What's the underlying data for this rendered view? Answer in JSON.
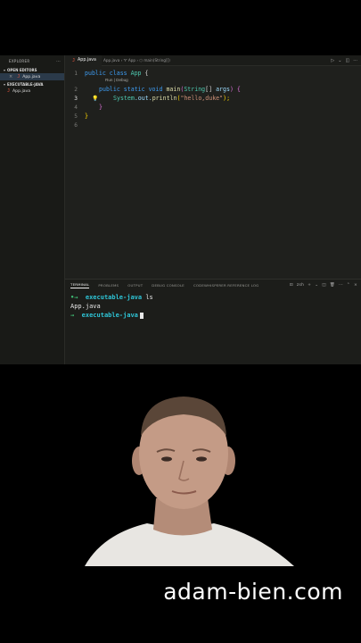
{
  "sidebar": {
    "title": "EXPLORER",
    "menu": "···",
    "open_editors_label": "OPEN EDITORS",
    "open_editor_file": "App.java",
    "folder_label": "EXECUTABLE-JAVA",
    "folder_file": "App.java"
  },
  "editor": {
    "tab_label": "App.java",
    "breadcrumb": "App.java › 🝖 App › ⬡ main(String[])",
    "codelens": "Run | Debug",
    "line_numbers": [
      "1",
      "2",
      "3",
      "4",
      "5",
      "6"
    ],
    "code": {
      "l1_kw": "public class ",
      "l1_type": "App",
      "l1_brace": " {",
      "l2_kw": "public static void ",
      "l2_fn": "main",
      "l2_paren": "(",
      "l2_type": "String",
      "l2_arr": "[] ",
      "l2_var": "args",
      "l2_close": ") {",
      "l3_sys": "System",
      "l3_out": ".out.",
      "l3_fn": "println",
      "l3_open": "(",
      "l3_str": "\"hello,duke\"",
      "l3_close": ");",
      "l4_brace": "}",
      "l5_brace": "}"
    }
  },
  "panel": {
    "tabs": [
      "TERMINAL",
      "PROBLEMS",
      "OUTPUT",
      "DEBUG CONSOLE",
      "CODEWHISPERER REFERENCE LOG"
    ],
    "shell": "zsh",
    "terminal": {
      "prompt_symbol": "→",
      "cwd": "executable-java",
      "command": "ls",
      "output": "App.java"
    }
  },
  "watermark": "adam-bien.com",
  "colors": {
    "accent": "#3d9bf0",
    "terminal_prompt": "#3fbd73",
    "terminal_cwd": "#2ec4d6"
  }
}
